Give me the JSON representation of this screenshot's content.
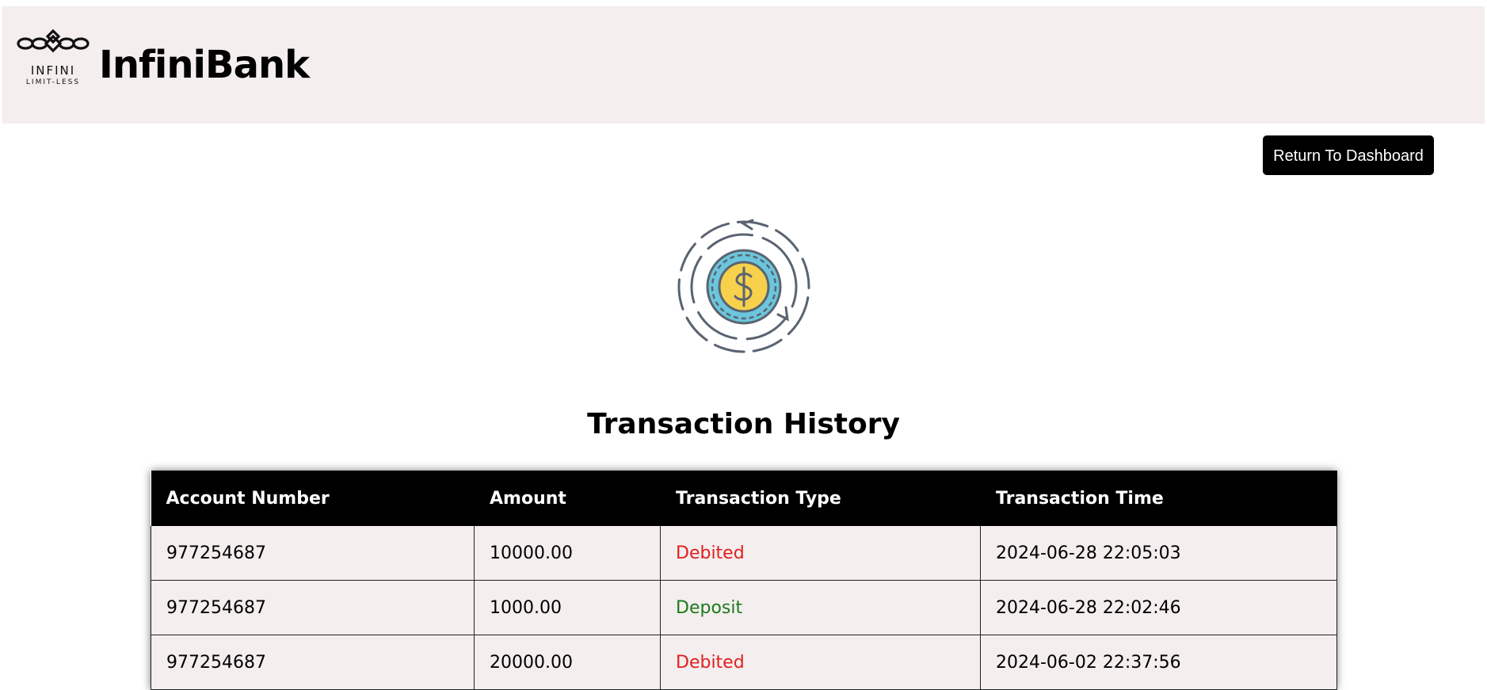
{
  "header": {
    "logo_text": "INFINI",
    "logo_tagline": "LIMIT-LESS",
    "brand": "InfiniBank"
  },
  "actions": {
    "return_label": "Return To Dashboard"
  },
  "hero": {
    "icon": "dollar-cycle-icon"
  },
  "page": {
    "title": "Transaction History"
  },
  "table": {
    "headers": [
      "Account Number",
      "Amount",
      "Transaction Type",
      "Transaction Time"
    ],
    "rows": [
      {
        "account": "977254687",
        "amount": "10000.00",
        "type": "Debited",
        "time": "2024-06-28 22:05:03"
      },
      {
        "account": "977254687",
        "amount": "1000.00",
        "type": "Deposit",
        "time": "2024-06-28 22:02:46"
      },
      {
        "account": "977254687",
        "amount": "20000.00",
        "type": "Debited",
        "time": "2024-06-02 22:37:56"
      }
    ]
  },
  "colors": {
    "header_bg": "#f4eeee",
    "debited": "#e02020",
    "deposit": "#1a7a1a"
  }
}
